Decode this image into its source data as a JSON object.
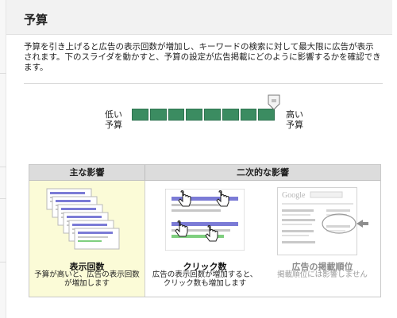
{
  "header": {
    "title": "予算"
  },
  "description": {
    "line1": "予算を引き上げると広告の表示回数が増加し、キーワードの検索に対して最大限に広告が表示",
    "line2": "されます。下のスライダを動かすと、予算の設定が広告掲載にどのように影響するかを確認でき",
    "line3": "ます。"
  },
  "slider": {
    "low_line1": "低い",
    "low_line2": "予算",
    "high_line1": "高い",
    "high_line2": "予算",
    "segments": 8,
    "value_fraction": 1.0
  },
  "impact": {
    "main_header": "主な影響",
    "secondary_header": "二次的な影響",
    "impressions": {
      "title": "表示回数",
      "text_line1": "予算が高いと、広告の表示回数",
      "text_line2": "が増加します"
    },
    "clicks": {
      "title": "クリック数",
      "text_line1": "広告の表示回数が増加すると、",
      "text_line2": "クリック数も増加します"
    },
    "position": {
      "title": "広告の掲載順位",
      "text_line1": "掲載順位には影響しません",
      "google_logo_text": "Google"
    }
  },
  "colors": {
    "slider_fill": "#3b8c61",
    "highlight_bg": "#fbfbd7",
    "header_bg": "#dcdcdc"
  }
}
